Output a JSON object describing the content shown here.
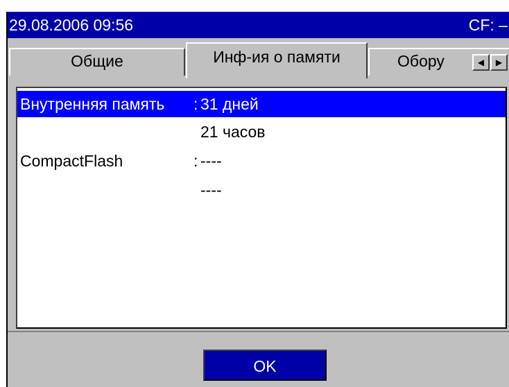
{
  "titlebar": {
    "datetime": "29.08.2006 09:56",
    "cf_status": "CF: –"
  },
  "tabs": [
    {
      "label": "Общие"
    },
    {
      "label": "Инф-ия о памяти",
      "active": true
    },
    {
      "label": "Обору"
    }
  ],
  "scroll": {
    "left_glyph": "◀",
    "right_glyph": "▶"
  },
  "memory_info": {
    "internal": {
      "label": "Внутренняя память",
      "colon": ":",
      "days": "31 дней",
      "hours": "21 часов"
    },
    "compactflash": {
      "label": "CompactFlash",
      "colon": ":",
      "value1": "----",
      "value2": "----"
    }
  },
  "buttons": {
    "ok_label": "OK"
  },
  "colors": {
    "titlebar_bg": "#0000a8",
    "selection_bg": "#0000ff",
    "panel_bg": "#c0c0c0",
    "button_bg": "#0000a8"
  }
}
